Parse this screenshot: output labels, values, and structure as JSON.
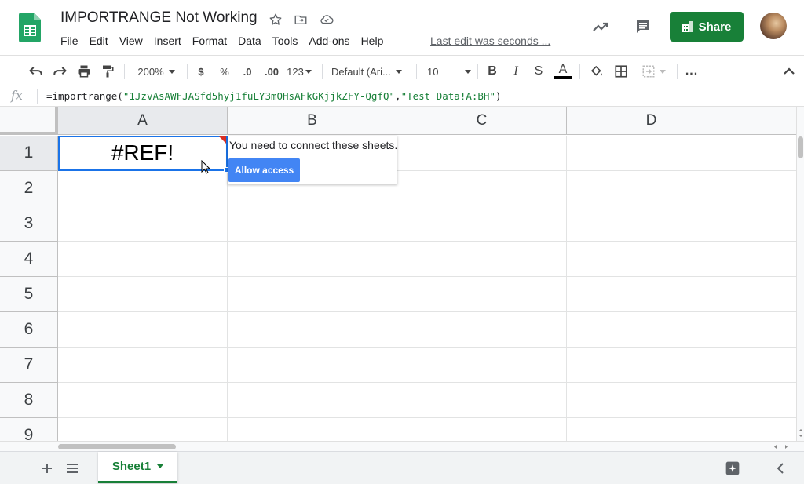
{
  "doc": {
    "title": "IMPORTRANGE Not Working",
    "last_edit": "Last edit was seconds ..."
  },
  "menu": [
    "File",
    "Edit",
    "View",
    "Insert",
    "Format",
    "Data",
    "Tools",
    "Add-ons",
    "Help"
  ],
  "header": {
    "share_label": "Share"
  },
  "toolbar": {
    "zoom": "200%",
    "currency": "$",
    "percent": "%",
    "decrease_decimal": ".0",
    "increase_decimal": ".00",
    "number_format": "123",
    "font": "Default (Ari...",
    "font_size": "10",
    "bold": "B",
    "italic": "I",
    "strike": "S",
    "text_color": "A",
    "more": "..."
  },
  "formula_bar": {
    "fx": "fx",
    "formula_prefix": "=importrange(",
    "arg1": "\"1JzvAsAWFJASfd5hyj1fuLY3mOHsAFkGKjjkZFY-QgfQ\"",
    "comma": ",",
    "arg2": "\"Test Data!A:BH\"",
    "formula_suffix": ")"
  },
  "grid": {
    "columns": [
      "A",
      "B",
      "C",
      "D"
    ],
    "rows": [
      "1",
      "2",
      "3",
      "4",
      "5",
      "6",
      "7",
      "8",
      "9"
    ],
    "a1_value": "#REF!"
  },
  "popup": {
    "message": "You need to connect these sheets.",
    "button": "Allow access"
  },
  "sheets": {
    "active": "Sheet1"
  },
  "colors": {
    "accent": "#188038",
    "selection": "#1a73e8",
    "error": "#d93025",
    "button_blue": "#4285f4"
  }
}
